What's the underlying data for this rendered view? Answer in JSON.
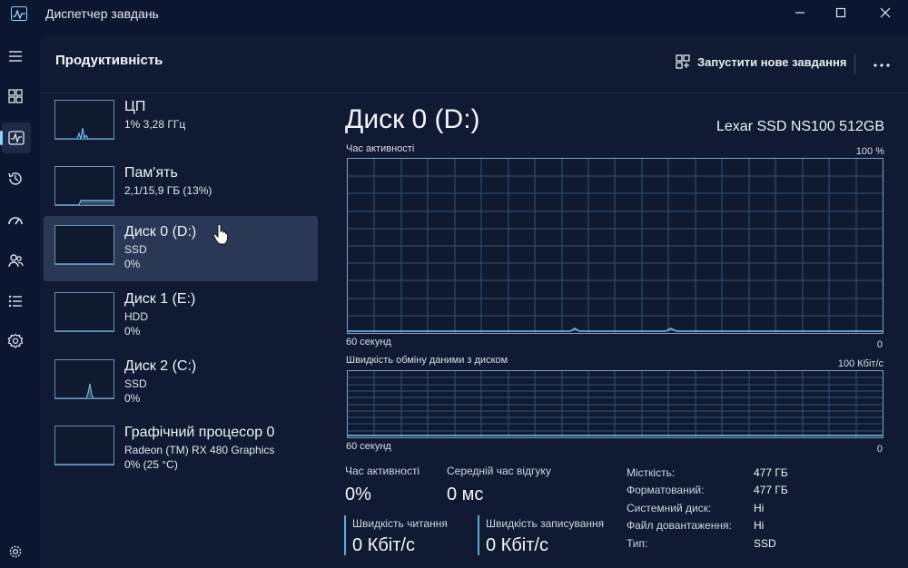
{
  "window": {
    "title": "Диспетчер завдань"
  },
  "nav": {
    "items": [
      {
        "icon": "hamburger-menu-icon"
      },
      {
        "icon": "processes-icon"
      },
      {
        "icon": "performance-icon",
        "active": true
      },
      {
        "icon": "app-history-icon"
      },
      {
        "icon": "startup-apps-icon"
      },
      {
        "icon": "users-icon"
      },
      {
        "icon": "details-icon"
      },
      {
        "icon": "services-icon"
      },
      {
        "icon": "settings-icon"
      }
    ]
  },
  "header": {
    "title": "Продуктивність",
    "new_task_label": "Запустити нове завдання"
  },
  "devices": [
    {
      "name": "ЦП",
      "line1": "1% 3,28 ГГц",
      "line2": ""
    },
    {
      "name": "Пам'ять",
      "line1": "2,1/15,9 ГБ (13%)",
      "line2": ""
    },
    {
      "name": "Диск 0 (D:)",
      "line1": "SSD",
      "line2": "0%",
      "selected": true
    },
    {
      "name": "Диск 1 (E:)",
      "line1": "HDD",
      "line2": "0%"
    },
    {
      "name": "Диск 2 (C:)",
      "line1": "SSD",
      "line2": "0%"
    },
    {
      "name": "Графічний процесор 0",
      "line1": "Radeon (TM) RX 480 Graphics",
      "line2": "0% (25 °C)"
    }
  ],
  "detail": {
    "title": "Диск 0 (D:)",
    "model": "Lexar SSD NS100 512GB",
    "activity_graph": {
      "label": "Час активності",
      "max_label": "100 %",
      "time_label": "60 секунд",
      "min_label": "0"
    },
    "transfer_graph": {
      "label": "Швидкість обміну даними з диском",
      "max_label": "100 Кбіт/с",
      "time_label": "60 секунд",
      "min_label": "0"
    },
    "stats": {
      "activity_label": "Час активності",
      "activity_value": "0%",
      "response_label": "Середній час відгуку",
      "response_value": "0 мс",
      "read_label": "Швидкість читання",
      "read_value": "0 Кбіт/с",
      "write_label": "Швидкість записування",
      "write_value": "0 Кбіт/с"
    },
    "properties": [
      {
        "key": "Місткість:",
        "value": "477 ГБ"
      },
      {
        "key": "Форматований:",
        "value": "477 ГБ"
      },
      {
        "key": "Системний диск:",
        "value": "Ні"
      },
      {
        "key": "Файл довантаження:",
        "value": "Ні"
      },
      {
        "key": "Тип:",
        "value": "SSD"
      }
    ]
  },
  "colors": {
    "accent": "#8fd1ff",
    "panel": "#101b33",
    "background": "#0b1630",
    "selected": "#2a3856"
  }
}
